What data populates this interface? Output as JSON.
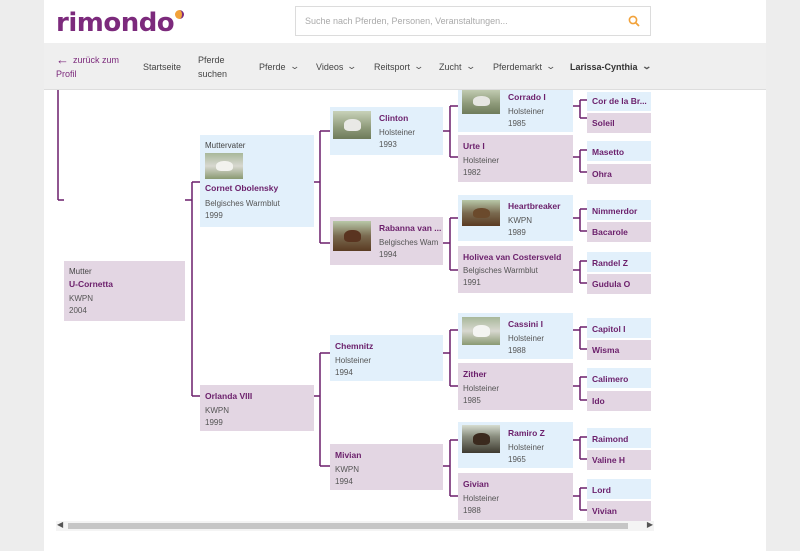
{
  "logo": "rimondo",
  "search": {
    "placeholder": "Suche nach Pferden, Personen, Veranstaltungen..."
  },
  "nav": {
    "back_label": "zurück zum Profil",
    "items": [
      {
        "label": "Startseite"
      },
      {
        "label": "Pferde suchen"
      },
      {
        "label": "Pferde"
      },
      {
        "label": "Videos"
      },
      {
        "label": "Reitsport"
      },
      {
        "label": "Zucht"
      },
      {
        "label": "Pferdemarkt"
      },
      {
        "label": "Larissa-Cynthia"
      }
    ]
  },
  "tree": {
    "mutter": {
      "label": "Mutter",
      "name": "U-Cornetta",
      "breed": "KWPN",
      "year": "2004"
    },
    "g1": [
      {
        "label": "Muttervater",
        "name": "Cornet Obolensky",
        "breed": "Belgisches Warmblut",
        "year": "1999"
      },
      {
        "name": "Orlanda VIII",
        "breed": "KWPN",
        "year": "1999"
      }
    ],
    "g2": [
      {
        "name": "Clinton",
        "breed": "Holsteiner",
        "year": "1993"
      },
      {
        "name": "Rabanna van ...",
        "breed": "Belgisches Wam",
        "year": "1994"
      },
      {
        "name": "Chemnitz",
        "breed": "Holsteiner",
        "year": "1994"
      },
      {
        "name": "Mivian",
        "breed": "KWPN",
        "year": "1994"
      }
    ],
    "g3": [
      {
        "name": "Corrado I",
        "breed": "Holsteiner",
        "year": "1985"
      },
      {
        "name": "Urte I",
        "breed": "Holsteiner",
        "year": "1982"
      },
      {
        "name": "Heartbreaker",
        "breed": "KWPN",
        "year": "1989"
      },
      {
        "name": "Holivea van Costersveld",
        "breed": "Belgisches Warmblut",
        "year": "1991"
      },
      {
        "name": "Cassini I",
        "breed": "Holsteiner",
        "year": "1988"
      },
      {
        "name": "Zither",
        "breed": "Holsteiner",
        "year": "1985"
      },
      {
        "name": "Ramiro Z",
        "breed": "Holsteiner",
        "year": "1965"
      },
      {
        "name": "Givian",
        "breed": "Holsteiner",
        "year": "1988"
      }
    ],
    "g4": [
      {
        "name": "Cor de la Br..."
      },
      {
        "name": "Soleil"
      },
      {
        "name": "Masetto"
      },
      {
        "name": "Ohra"
      },
      {
        "name": "Nimmerdor"
      },
      {
        "name": "Bacarole"
      },
      {
        "name": "Randel Z"
      },
      {
        "name": "Gudula O"
      },
      {
        "name": "Capitol I"
      },
      {
        "name": "Wisma"
      },
      {
        "name": "Calimero"
      },
      {
        "name": "Ido"
      },
      {
        "name": "Raimond"
      },
      {
        "name": "Valine H"
      },
      {
        "name": "Lord"
      },
      {
        "name": "Vivian"
      }
    ]
  },
  "colors": {
    "brand": "#7c2a7c",
    "accent": "#f2a23a",
    "sire_box": "#e2f0fb",
    "dam_box": "#e3d6e3"
  }
}
